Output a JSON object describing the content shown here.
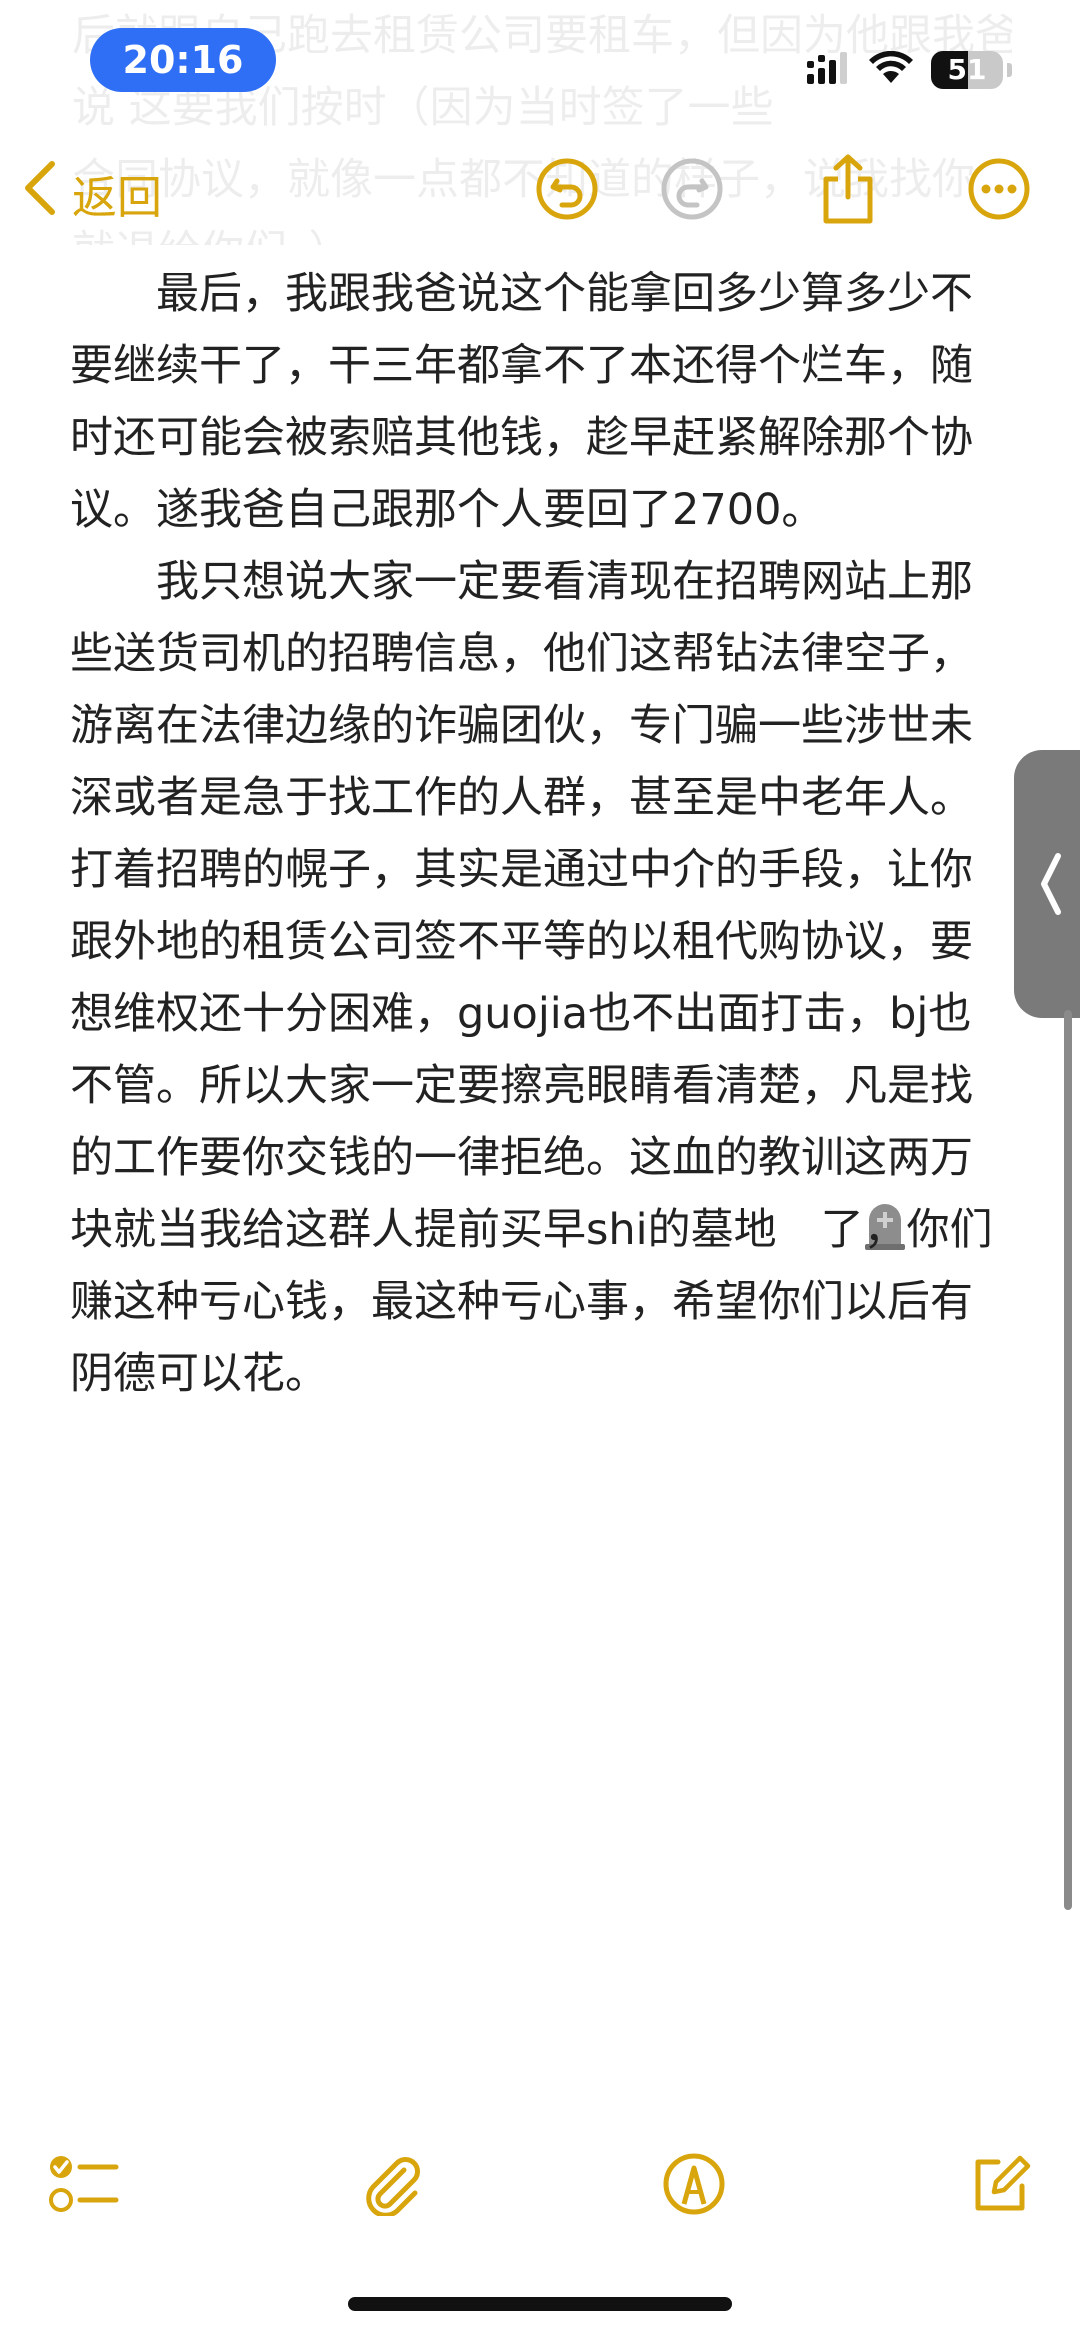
{
  "status_bar": {
    "time": "20:16",
    "battery": "51",
    "battery_level": 0.51
  },
  "nav": {
    "back_label": "返回"
  },
  "ghost_lines": [
    "后就跟自己跑去租赁公司要租车，但因为他跟我爸",
    "说 这要我们按时（因为当时签了一些",
    "合同协议，就像一点都不知道的样子，说我找你",
    "就退给你们。）"
  ],
  "note": {
    "paragraphs": [
      {
        "id": "p1",
        "parts": [
          {
            "type": "text",
            "text": "最后，我跟我爸说这个能拿回多少算多少不要继续干了，干三年都拿不了本还得个烂车，随时还可能会被索赔其他钱，趁早赶紧解除那个协议。遂我爸自己跟那个人要回了2700。"
          }
        ]
      },
      {
        "id": "p2",
        "parts": [
          {
            "type": "text",
            "text": "我只想说大家一定要看清现在招聘网站上那些送货司机的招聘信息，他们这帮钻法律空子，游离在法律边缘的诈骗团伙，专门骗一些涉世未深或者是急于找工作的人群，甚至是中老年人。打着招聘的幌子，其实是通过中介的手段，让你跟外地的租赁公司签不平等的以租代购协议，要想维权还十分困难，guojia也不出面打击，bj也不管。所以大家一定要擦亮眼睛看清楚，凡是找的工作要你交钱的一律拒绝。这血的教训这两万块就当我给这群人提前买早shi的墓地"
          },
          {
            "type": "icon",
            "name": "headstone-icon"
          },
          {
            "type": "text",
            "text": "了，你们赚这种亏心钱，最这种亏心事，希望你们以后有阴德可以花。"
          }
        ]
      }
    ]
  },
  "colors": {
    "accent": "#d9a50c",
    "time_pill": "#2f6ff5",
    "text": "#222222",
    "disabled": "#c4c4c4"
  },
  "icons": {
    "back": "chevron-left-icon",
    "undo": "undo-icon",
    "redo": "redo-icon",
    "share": "share-icon",
    "more": "more-icon",
    "checklist": "checklist-icon",
    "attachment": "paperclip-icon",
    "markup": "markup-pen-icon",
    "compose": "compose-icon",
    "side_handle": "chevron-left-icon"
  }
}
